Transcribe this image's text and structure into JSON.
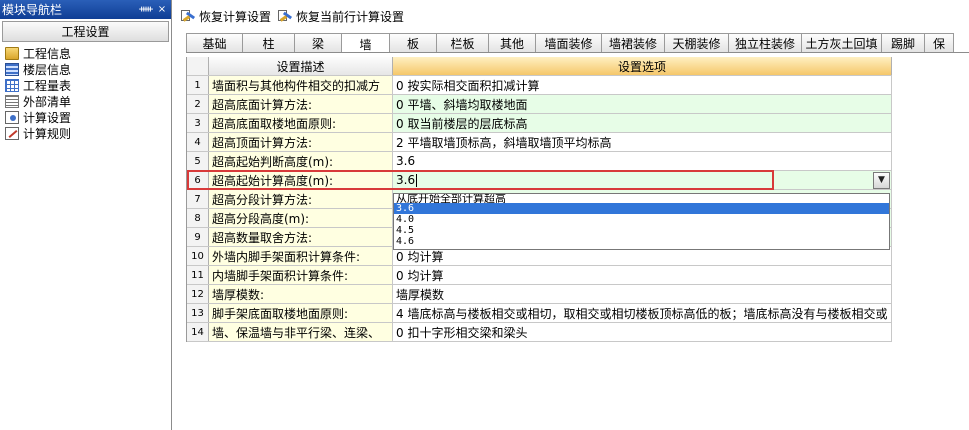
{
  "nav": {
    "title": "模块导航栏",
    "pin": "ᚔ",
    "close": "×",
    "group": "工程设置",
    "items": [
      {
        "label": "工程信息",
        "icon": "folder-icon"
      },
      {
        "label": "楼层信息",
        "icon": "layers-icon"
      },
      {
        "label": "工程量表",
        "icon": "table-icon"
      },
      {
        "label": "外部清单",
        "icon": "list-icon"
      },
      {
        "label": "计算设置",
        "icon": "settings-icon"
      },
      {
        "label": "计算规则",
        "icon": "rule-icon"
      }
    ]
  },
  "toolbar": {
    "restore_settings": "恢复计算设置",
    "restore_current_row": "恢复当前行计算设置"
  },
  "tabs": [
    "基础",
    "柱",
    "梁",
    "墙",
    "板",
    "栏板",
    "其他",
    "墙面装修",
    "墙裙装修",
    "天棚装修",
    "独立柱装修",
    "土方灰土回填",
    "踢脚",
    "保"
  ],
  "active_tab": "墙",
  "grid": {
    "header_desc": "设置描述",
    "header_option": "设置选项",
    "rows": [
      {
        "no": "1",
        "desc": "墙面积与其他构件相交的扣减方",
        "option": "0 按实际相交面积扣减计算"
      },
      {
        "no": "2",
        "desc": "超高底面计算方法:",
        "option": "0 平墙、斜墙均取楼地面"
      },
      {
        "no": "3",
        "desc": "超高底面取楼地面原则:",
        "option": "0 取当前楼层的层底标高"
      },
      {
        "no": "4",
        "desc": "超高顶面计算方法:",
        "option": "2 平墙取墙顶标高，斜墙取墙顶平均标高"
      },
      {
        "no": "5",
        "desc": "超高起始判断高度(m):",
        "option": "3.6"
      },
      {
        "no": "6",
        "desc": "超高起始计算高度(m):",
        "option": "3.6"
      },
      {
        "no": "7",
        "desc": "超高分段计算方法:",
        "option": ""
      },
      {
        "no": "8",
        "desc": "超高分段高度(m):",
        "option": ""
      },
      {
        "no": "9",
        "desc": "超高数量取舍方法:",
        "option": ""
      },
      {
        "no": "10",
        "desc": "外墙内脚手架面积计算条件:",
        "option": "0 均计算"
      },
      {
        "no": "11",
        "desc": "内墙脚手架面积计算条件:",
        "option": "0 均计算"
      },
      {
        "no": "12",
        "desc": "墙厚模数:",
        "option": "墙厚模数"
      },
      {
        "no": "13",
        "desc": "脚手架底面取楼地面原则:",
        "option": "4 墙底标高与楼板相交或相切，取相交或相切楼板顶标高低的板；墙底标高没有与楼板相交或"
      },
      {
        "no": "14",
        "desc": "墙、保温墙与非平行梁、连梁、",
        "option": "0 扣十字形相交梁和梁头"
      }
    ]
  },
  "dropdown": {
    "hidden_text": "从底开始全部计算超高",
    "options": [
      "3.6",
      "4.0",
      "4.5",
      "4.6"
    ],
    "selected": "3.6"
  },
  "colors": {
    "highlight_border": "#d83a3a",
    "selected_option": "#3176d9",
    "green_cell": "#e7fde7",
    "desc_cell": "#ffffe1",
    "header_option": "#f5c76a"
  }
}
